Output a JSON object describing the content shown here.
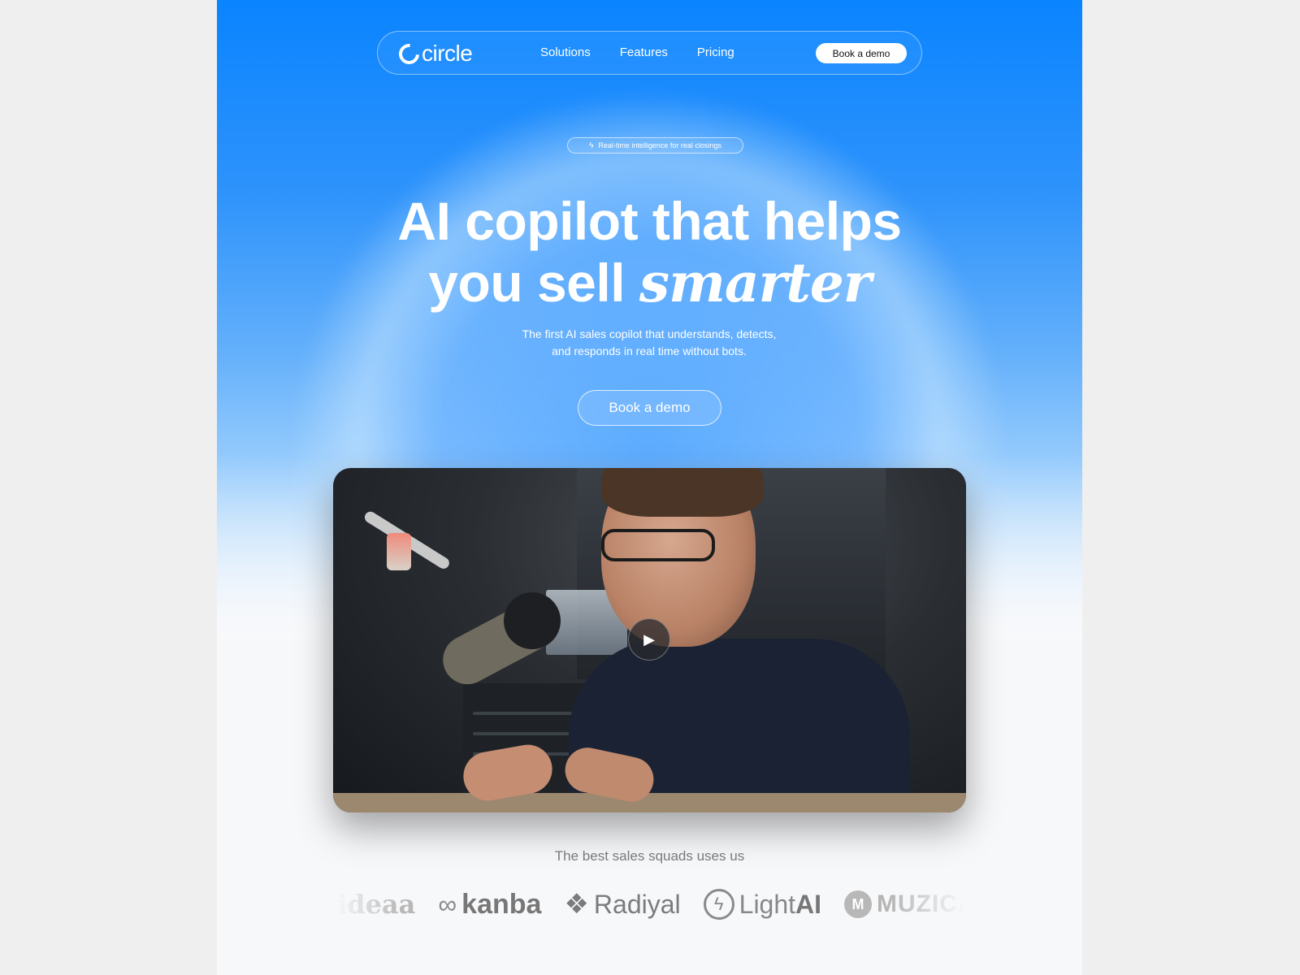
{
  "nav": {
    "logo_text": "circle",
    "links": [
      "Solutions",
      "Features",
      "Pricing"
    ],
    "cta_label": "Book a demo"
  },
  "badge": {
    "icon": "lightning-icon",
    "text": "Real-time intelligence for real closings"
  },
  "hero": {
    "headline_line1": "AI copilot that helps",
    "headline_line2_plain": "you sell ",
    "headline_line2_accent": "smarter",
    "subtitle_line1": "The first AI sales copilot that understands, detects,",
    "subtitle_line2": "and responds in real time without bots.",
    "cta_label": "Book a demo"
  },
  "video": {
    "play_icon": "play-icon"
  },
  "social_proof": {
    "heading": "The best sales squads uses us",
    "logos": [
      "ideaa",
      "kanba",
      "Radiyal",
      "Light",
      "AI",
      "MUZICA"
    ]
  },
  "colors": {
    "brand_blue": "#0a84ff",
    "light_blue": "#9fd0fd",
    "white": "#ffffff"
  }
}
